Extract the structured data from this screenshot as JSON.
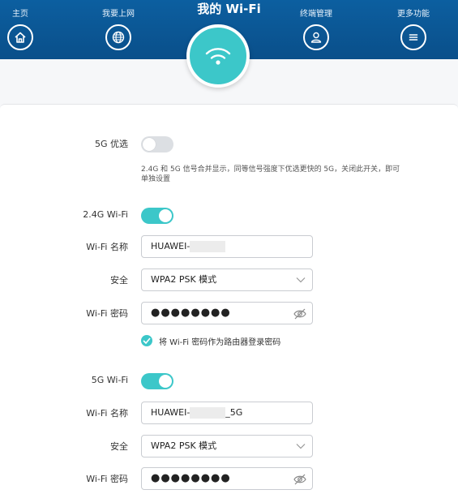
{
  "nav": {
    "title": "我的 Wi-Fi",
    "items": [
      {
        "label": "主页",
        "icon": "home-icon"
      },
      {
        "label": "我要上网",
        "icon": "globe-icon"
      },
      {
        "label": "终端管理",
        "icon": "user-icon"
      },
      {
        "label": "更多功能",
        "icon": "menu-icon"
      }
    ],
    "badge_icon": "wifi-icon"
  },
  "priority_5g": {
    "label": "5G 优选",
    "enabled": false,
    "hint": "2.4G 和 5G 信号合并显示，同等信号强度下优选更快的 5G，关闭此开关，即可单独设置"
  },
  "wifi_24g": {
    "section_label": "2.4G Wi-Fi",
    "enabled": true,
    "name_label": "Wi-Fi 名称",
    "name_prefix": "HUAWEI-",
    "name_suffix": "",
    "security_label": "安全",
    "security_value": "WPA2 PSK 模式",
    "password_label": "Wi-Fi 密码",
    "password_value": "●●●●●●●●",
    "use_as_login_label": "将 Wi-Fi 密码作为路由器登录密码",
    "use_as_login_checked": true
  },
  "wifi_5g": {
    "section_label": "5G Wi-Fi",
    "enabled": true,
    "name_label": "Wi-Fi 名称",
    "name_prefix": "HUAWEI-",
    "name_suffix": "_5G",
    "security_label": "安全",
    "security_value": "WPA2 PSK 模式",
    "password_label": "Wi-Fi 密码",
    "password_value": "●●●●●●●●"
  },
  "colors": {
    "header": "#0c5fa0",
    "accent": "#3cc7c9"
  }
}
